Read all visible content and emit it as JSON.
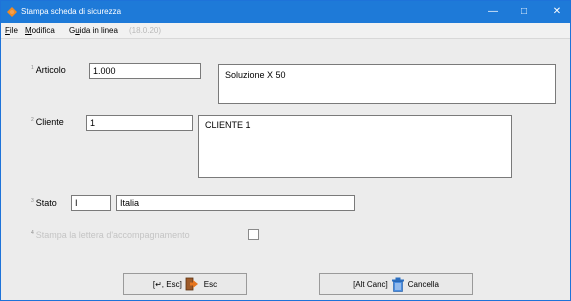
{
  "window": {
    "title": "Stampa scheda di sicurezza",
    "icons": {
      "app": "orange-app-icon",
      "minimize": "minimize-icon",
      "maximize": "maximize-icon",
      "close": "close-icon"
    }
  },
  "menu": {
    "file_u": "F",
    "file_rest": "ile",
    "modifica_u": "M",
    "modifica_rest": "odifica",
    "guida_pre": "G",
    "guida_u": "u",
    "guida_rest": "ida in linea",
    "version": "(18.0.20)"
  },
  "form": {
    "articolo": {
      "number": "1",
      "label": "Articolo",
      "value": "1.000",
      "description": "Soluzione X 50"
    },
    "cliente": {
      "number": "2",
      "label": "Cliente",
      "value": "1",
      "description": "CLIENTE 1"
    },
    "stato": {
      "number": "3",
      "label": "Stato",
      "value": "I",
      "description": "Italia"
    },
    "lettera": {
      "number": "4",
      "label": "Stampa la lettera d'accompagnamento",
      "checked": false
    }
  },
  "buttons": {
    "esc": {
      "shortcut": "[↵, Esc]",
      "label": "Esc",
      "icon": "exit-door-icon"
    },
    "cancella": {
      "shortcut": "[Alt Canc]",
      "label": "Cancella",
      "icon": "trash-bin-icon"
    }
  }
}
